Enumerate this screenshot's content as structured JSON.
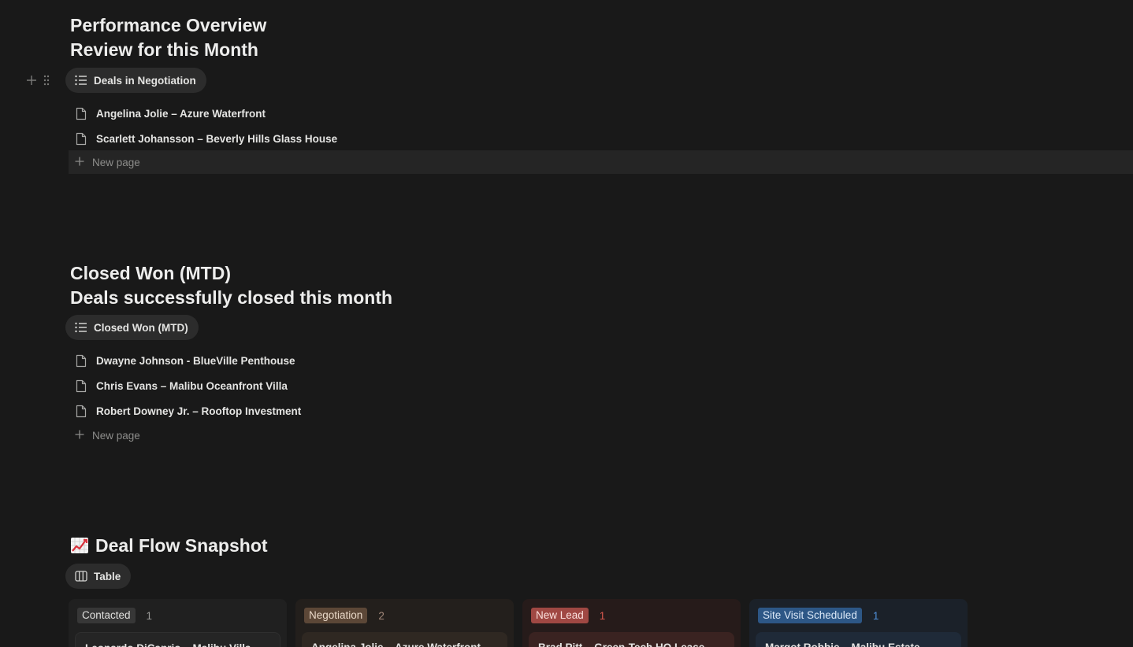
{
  "section1": {
    "title": "Performance Overview",
    "subtitle": "Review for this Month",
    "view_tab": "Deals in Negotiation",
    "items": [
      "Angelina Jolie – Azure Waterfront",
      "Scarlett Johansson – Beverly Hills Glass House"
    ],
    "new_page": "New page"
  },
  "section2": {
    "title": "Closed Won (MTD)",
    "subtitle": "Deals successfully closed this month",
    "view_tab": "Closed Won (MTD)",
    "items": [
      "Dwayne Johnson - BlueVille Penthouse",
      "Chris Evans – Malibu Oceanfront Villa",
      "Robert Downey Jr. – Rooftop Investment"
    ],
    "new_page": "New page"
  },
  "section3": {
    "emoji_icon": "chart-increasing-icon",
    "title": "Deal Flow Snapshot",
    "view_tab": "Table",
    "columns": [
      {
        "label": "Contacted",
        "count": "1",
        "card": "Leonardo DiCaprio – Malibu Villa",
        "badge_bg": "#373737",
        "badge_fg": "#e0e0de",
        "count_fg": "#9b9b99",
        "col_bg": "#202020",
        "card_bg": "#252525"
      },
      {
        "label": "Negotiation",
        "count": "2",
        "card": "Angelina Jolie – Azure Waterfront",
        "badge_bg": "#5c4737",
        "badge_fg": "#e9d8c8",
        "count_fg": "#a2887a",
        "col_bg": "#231f1c",
        "card_bg": "#2f2822"
      },
      {
        "label": "New Lead",
        "count": "1",
        "card": "Brad Pitt – Green-Tech HQ Lease",
        "badge_bg": "#a04843",
        "badge_fg": "#fbe1de",
        "count_fg": "#d9584e",
        "col_bg": "#261b1a",
        "card_bg": "#3a2321"
      },
      {
        "label": "Site Visit Scheduled",
        "count": "1",
        "card": "Margot Robbie – Malibu Estate",
        "badge_bg": "#2d5786",
        "badge_fg": "#dbe8f7",
        "count_fg": "#4f8fd8",
        "col_bg": "#1b2129",
        "card_bg": "#1f2a38"
      }
    ]
  }
}
